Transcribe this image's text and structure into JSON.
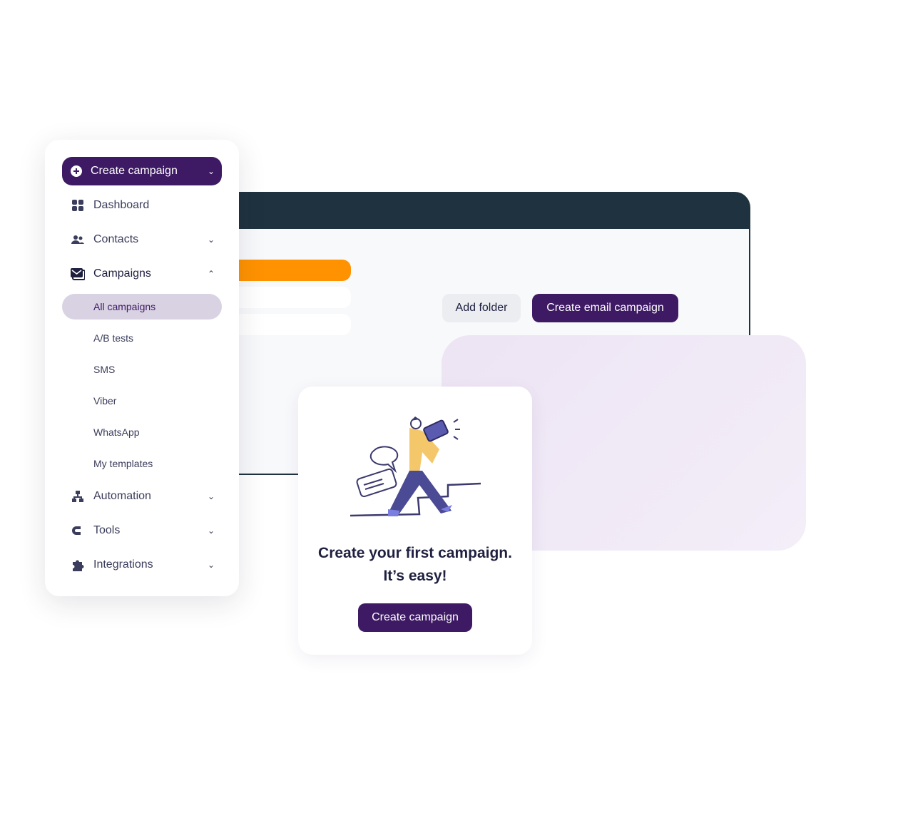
{
  "sidebar": {
    "create_button": "Create campaign",
    "items": [
      {
        "label": "Dashboard",
        "icon": "grid-icon"
      },
      {
        "label": "Contacts",
        "icon": "users-icon"
      },
      {
        "label": "Campaigns",
        "icon": "mail-icon"
      }
    ],
    "sub_items": [
      "All campaigns",
      "A/B tests",
      "SMS",
      "Viber",
      "WhatsApp",
      "My templates"
    ],
    "active_sub": "All campaigns",
    "bottom_items": [
      {
        "label": "Automation",
        "icon": "sitemap-icon"
      },
      {
        "label": "Tools",
        "icon": "magnet-icon"
      },
      {
        "label": "Integrations",
        "icon": "puzzle-icon"
      }
    ]
  },
  "toolbar": {
    "add_folder": "Add folder",
    "create_email": "Create email campaign"
  },
  "empty_state": {
    "title_line1": "Create your first campaign.",
    "title_line2": "It’s easy!",
    "button": "Create campaign"
  },
  "colors": {
    "primary": "#3d1a63",
    "orange": "#ff9200",
    "header": "#1f323f",
    "active_bg": "#d9d2e3"
  }
}
